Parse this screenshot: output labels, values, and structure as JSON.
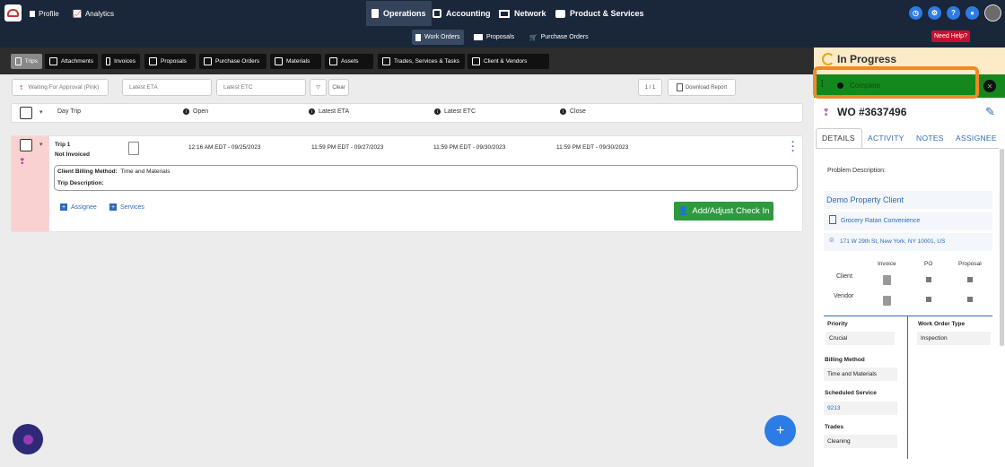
{
  "nav": {
    "profile": "Profile",
    "analytics": "Analytics",
    "operations": "Operations",
    "accounting": "Accounting",
    "network": "Network",
    "products": "Product & Services"
  },
  "subnav": {
    "work_orders": "Work Orders",
    "proposals": "Proposals",
    "purchase_orders": "Purchase Orders",
    "need_help": "Need Help?"
  },
  "tabs": [
    "Trips",
    "Attachments",
    "Invoices",
    "Proposals",
    "Purchase Orders",
    "Materials",
    "Assets",
    "Trades, Services & Tasks",
    "Client & Vendors"
  ],
  "filters": {
    "status": "Waiting For Approval (Pink)",
    "eta_placeholder": "Latest ETA",
    "etc_placeholder": "Latest ETC",
    "clear": "Clear",
    "page": "1  /  1",
    "download": "Download Report"
  },
  "table": {
    "headers": [
      "Day Trip",
      "Open",
      "Latest ETA",
      "Latest ETC",
      "Close"
    ]
  },
  "trip": {
    "name": "Trip 1",
    "invoice_status": "Not Invoiced",
    "open": "12:16 AM EDT - 09/25/2023",
    "eta": "11:59 PM EDT - 09/27/2023",
    "etc": "11:59 PM EDT - 09/30/2023",
    "close": "11:59 PM EDT - 09/30/2023",
    "billing_label": "Client Billing Method:",
    "billing_value": "Time and Materials",
    "description_label": "Trip Description:",
    "assignee": "Assignee",
    "services": "Services",
    "checkin": "Add/Adjust Check In"
  },
  "panel": {
    "status": "In Progress",
    "next_status": "Complete",
    "wo_number": "WO #3637496",
    "tabs": [
      "DETAILS",
      "ACTIVITY",
      "NOTES",
      "ASSIGNEE"
    ],
    "problem_label": "Problem Description:",
    "client": "Demo Property Client",
    "store": "Grocery Ratan Convenience",
    "address": "171 W 29th St, New York, NY 10001, US",
    "doc_headers": [
      "Invoice",
      "PO",
      "Proposal"
    ],
    "doc_rows": [
      "Client",
      "Vendor"
    ],
    "priority_label": "Priority",
    "priority": "Crucial",
    "wo_type_label": "Work Order Type",
    "wo_type": "Inspection",
    "billing_label": "Billing Method",
    "billing": "Time and Materials",
    "service_label": "Scheduled Service",
    "service": "9213",
    "trades_label": "Trades",
    "trades": "Cleaning"
  },
  "colors": {
    "nav_bg": "#1a2639",
    "accent_blue": "#2d7be5",
    "complete_green": "#16871c",
    "checkin_green": "#2e9a3e",
    "highlight_orange": "#f08a24",
    "pink": "#fad1d1"
  }
}
